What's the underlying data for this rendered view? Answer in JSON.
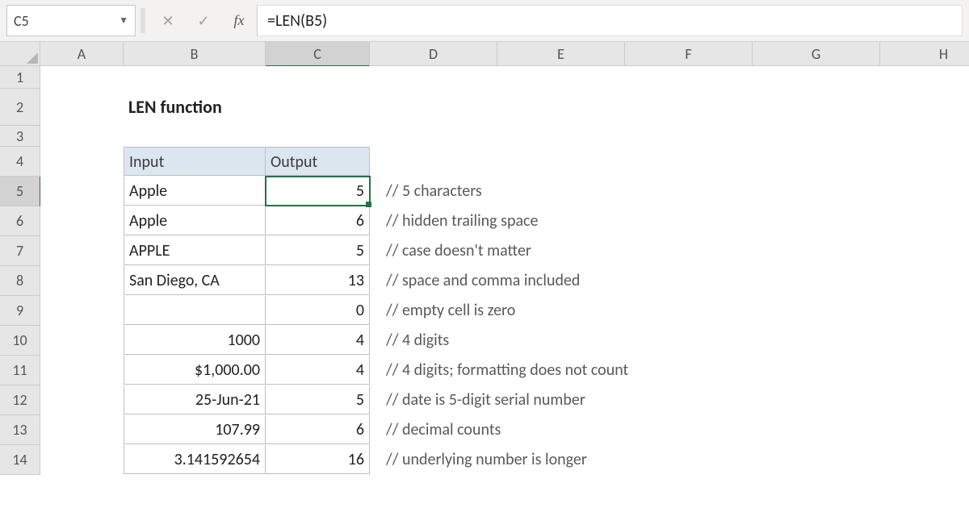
{
  "formula_bar": {
    "cell_ref": "C5",
    "formula": "=LEN(B5)"
  },
  "columns": [
    "A",
    "B",
    "C",
    "D",
    "E",
    "F",
    "G",
    "H"
  ],
  "row_numbers": [
    "1",
    "2",
    "3",
    "4",
    "5",
    "6",
    "7",
    "8",
    "9",
    "10",
    "11",
    "12",
    "13",
    "14"
  ],
  "title": "LEN function",
  "table_headers": {
    "input": "Input",
    "output": "Output"
  },
  "rows": [
    {
      "input": "Apple",
      "output": "5",
      "comment": "// 5 characters"
    },
    {
      "input": "Apple",
      "output": "6",
      "comment": "// hidden trailing space"
    },
    {
      "input": "APPLE",
      "output": "5",
      "comment": "// case doesn't matter"
    },
    {
      "input": "San Diego, CA",
      "output": "13",
      "comment": "// space and comma included"
    },
    {
      "input": "",
      "output": "0",
      "comment": "// empty cell is zero"
    },
    {
      "input": "1000",
      "input_num": true,
      "output": "4",
      "comment": "// 4 digits"
    },
    {
      "input": "$1,000.00",
      "input_num": true,
      "output": "4",
      "comment": "// 4 digits; formatting does not count"
    },
    {
      "input": "25-Jun-21",
      "input_num": true,
      "output": "5",
      "comment": "// date is 5-digit serial number"
    },
    {
      "input": "107.99",
      "input_num": true,
      "output": "6",
      "comment": "// decimal counts"
    },
    {
      "input": "3.141592654",
      "input_num": true,
      "output": "16",
      "comment": "// underlying number is longer"
    }
  ],
  "chart_data": {
    "type": "table",
    "title": "LEN function",
    "columns": [
      "Input",
      "Output"
    ],
    "data": [
      [
        "Apple",
        5
      ],
      [
        "Apple",
        6
      ],
      [
        "APPLE",
        5
      ],
      [
        "San Diego, CA",
        13
      ],
      [
        "",
        0
      ],
      [
        "1000",
        4
      ],
      [
        "$1,000.00",
        4
      ],
      [
        "25-Jun-21",
        5
      ],
      [
        "107.99",
        6
      ],
      [
        "3.141592654",
        16
      ]
    ]
  }
}
